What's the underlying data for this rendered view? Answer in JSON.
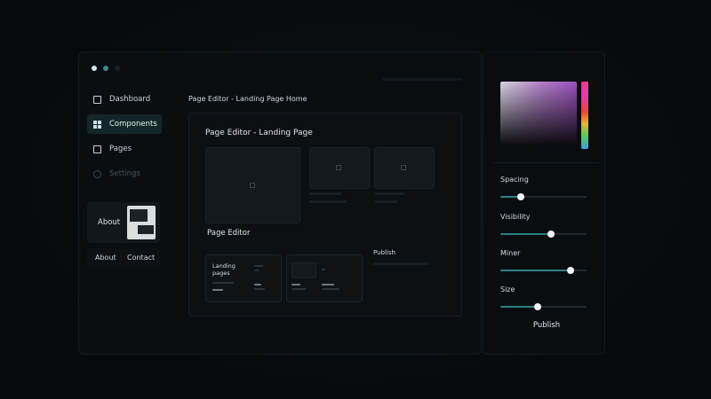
{
  "window_dots": [
    {
      "color": "#cfe6ea"
    },
    {
      "color": "#3f8b8b"
    },
    {
      "color": "#1b2226"
    }
  ],
  "sidebar": {
    "items": [
      {
        "label": "Dashboard",
        "icon": "square-outline-icon",
        "state": "normal"
      },
      {
        "label": "Components",
        "icon": "grid-icon",
        "state": "active"
      },
      {
        "label": "Pages",
        "icon": "square-outline-icon",
        "state": "normal"
      },
      {
        "label": "Settings",
        "icon": "circle-outline-icon",
        "state": "disabled"
      }
    ],
    "about_card": {
      "label": "About"
    },
    "links": {
      "about": "About",
      "contact": "Contact"
    }
  },
  "main": {
    "breadcrumb": "Page Editor - Landing Page Home",
    "editor": {
      "title": "Page Editor - Landing Page",
      "subtitle": "Page Editor",
      "publish": "Publish",
      "mini_card": {
        "title": "Landing pages"
      }
    }
  },
  "right_panel": {
    "controls": [
      {
        "label": "Spacing",
        "value": 0.24
      },
      {
        "label": "Visibility",
        "value": 0.59
      },
      {
        "label": "Miner",
        "value": 0.81
      },
      {
        "label": "Size",
        "value": 0.43
      }
    ],
    "publish": "Publish"
  },
  "colors": {
    "accent": "#2d7e86",
    "active_nav": "#13262a",
    "background": "#07090b"
  }
}
